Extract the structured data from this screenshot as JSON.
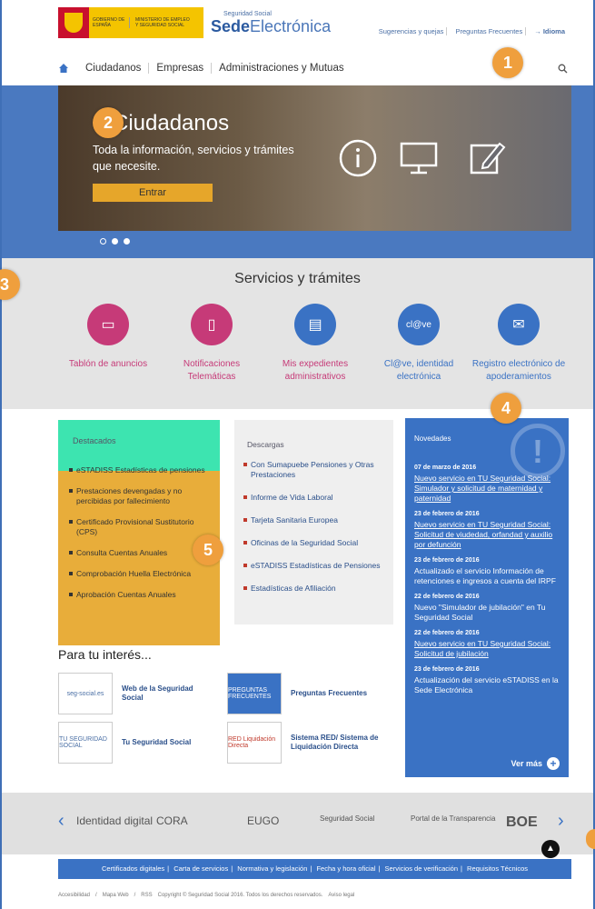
{
  "header": {
    "gov_logo_line1": "GOBIERNO DE ESPAÑA",
    "gov_logo_line2": "MINISTERIO DE EMPLEO Y SEGURIDAD SOCIAL",
    "sede_small": "Seguridad Social",
    "sede_bold": "Sede",
    "sede_rest": "Electrónica",
    "links": [
      "Sugerencias y quejas",
      "Preguntas Frecuentes",
      "→ Idioma"
    ]
  },
  "nav": {
    "items": [
      "Ciudadanos",
      "Empresas",
      "Administraciones y Mutuas"
    ],
    "search_icon": "search-icon"
  },
  "hero": {
    "title": "Ciudadanos",
    "text": "Toda la información, servicios y trámites que necesite.",
    "button": "Entrar"
  },
  "services": {
    "title": "Servicios y trámites",
    "items": [
      {
        "label": "Tablón de anuncios",
        "color": "#c63a78",
        "icon": "board-icon"
      },
      {
        "label": "Notificaciones Telemáticas",
        "color": "#c63a78",
        "icon": "notification-icon"
      },
      {
        "label": "Mis expedientes administrativos",
        "color": "#3a72c4",
        "icon": "document-icon"
      },
      {
        "label": "Cl@ve, identidad electrónica",
        "color": "#3a72c4",
        "icon": "clave-icon"
      },
      {
        "label": "Registro electrónico de apoderamientos",
        "color": "#3a72c4",
        "icon": "mail-icon"
      }
    ]
  },
  "destacados": {
    "title": "Destacados",
    "items": [
      "eSTADISS Estadísticas de pensiones",
      "Prestaciones devengadas y no percibidas por fallecimiento",
      "Certificado Provisional Sustitutorio (CPS)",
      "Consulta Cuentas Anuales",
      "Comprobación Huella Electrónica",
      "Aprobación Cuentas Anuales"
    ]
  },
  "descargas": {
    "title": "Descargas",
    "items": [
      "Con Sumapuebe Pensiones y Otras Prestaciones",
      "Informe de Vida Laboral",
      "Tarjeta Sanitaria Europea",
      "Oficinas de la Seguridad Social",
      "eSTADISS Estadísticas de Pensiones",
      "Estadísticas de Afiliación"
    ]
  },
  "novedades": {
    "title": "Novedades",
    "items": [
      {
        "date": "07 de marzo de 2016",
        "text": "Nuevo servicio en TU Seguridad Social: Simulador y solicitud de maternidad y paternidad",
        "underline": true
      },
      {
        "date": "23 de febrero de 2016",
        "text": "Nuevo servicio en TU Seguridad Social: Solicitud de viudedad, orfandad y auxilio por defunción",
        "underline": true
      },
      {
        "date": "23 de febrero de 2016",
        "text": "Actualizado el servicio Información de retenciones e ingresos a cuenta del IRPF",
        "underline": false
      },
      {
        "date": "22 de febrero de 2016",
        "text": "Nuevo \"Simulador de jubilación\" en Tu Seguridad Social",
        "underline": false
      },
      {
        "date": "22 de febrero de 2016",
        "text": "Nuevo servicio en TU Seguridad Social: Solicitud de jubilación",
        "underline": true
      },
      {
        "date": "23 de febrero de 2016",
        "text": "Actualización del servicio eSTADISS en la Sede Electrónica",
        "underline": false
      }
    ],
    "more": "Ver más"
  },
  "interest": {
    "title": "Para tu interés...",
    "items": [
      {
        "thumb": "seg-social.es",
        "label": "Web de la Seguridad Social"
      },
      {
        "thumb": "PREGUNTAS FRECUENTES",
        "label": "Preguntas Frecuentes"
      },
      {
        "thumb": "TU SEGURIDAD SOCIAL",
        "label": "Tu Seguridad Social"
      },
      {
        "thumb": "RED Liquidación Directa",
        "label": "Sistema RED/ Sistema de Liquidación Directa"
      }
    ]
  },
  "logos": [
    "Identidad digital",
    "CORA",
    "EUGO",
    "Seguridad Social",
    "Portal de la Transparencia",
    "BOE"
  ],
  "footer": {
    "links": [
      "Certificados digitales",
      "Carta de servicios",
      "Normativa y legislación",
      "Fecha y hora oficial",
      "Servicios de verificación",
      "Requisitos Técnicos"
    ],
    "bottom": [
      "Accesibilidad",
      "Mapa Web",
      "RSS",
      "Copyright © Seguridad Social 2016. Todos los derechos reservados.",
      "Aviso legal"
    ]
  },
  "badges": [
    "1",
    "2",
    "3",
    "4",
    "5"
  ],
  "colors": {
    "brand_blue": "#3a72c4",
    "badge_orange": "#ef9f3d",
    "hero_button": "#e6a62a",
    "magenta": "#c63a78"
  }
}
